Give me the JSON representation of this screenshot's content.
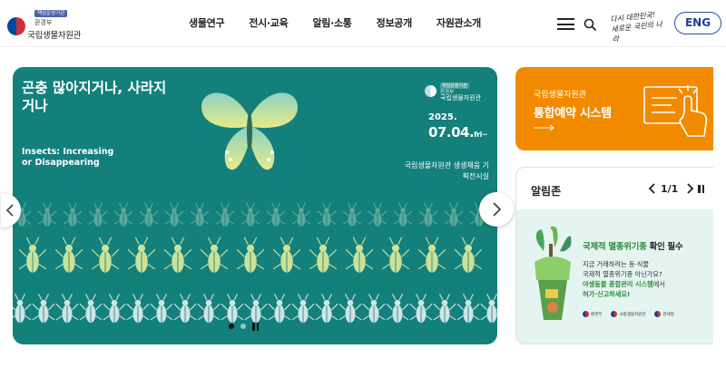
{
  "header": {
    "logo": {
      "badge": "책임운영기관",
      "ministry": "환경부",
      "name": "국립생물자원관"
    },
    "nav": [
      "생물연구",
      "전시·교육",
      "알림·소통",
      "정보공개",
      "자원관소개"
    ],
    "slogan": "다시 대한민국! 새로운 국민의 나라",
    "lang_button": "ENG"
  },
  "hero": {
    "title": "곤충 많아지거나, 사라지거나",
    "subtitle": "Insects: Increasing or Disappearing",
    "org_badge": "책임운영기관",
    "org_ministry": "환경부",
    "org_name": "국립생물자원관",
    "year": "2025.",
    "date": "07.04.",
    "weekday": "fri~",
    "venue": "국립생물자원관 생생채움 기획전시실",
    "slides_total": 2,
    "slide_active": 1,
    "colors": {
      "background": "#13807c",
      "beetle": "#d6e89a",
      "butterfly": "#c5e0a5"
    }
  },
  "reservation": {
    "subtitle": "국립생물자원관",
    "title": "통합예약 시스템",
    "color": "#f28a00"
  },
  "notice": {
    "title": "알림존",
    "page": "1/1",
    "heading_highlight": "국제적 멸종위기종",
    "heading_rest": " 확인 필수",
    "line1": "지금 거래하려는 동·식물",
    "line2": "국제적 멸종위기종 아닌가요?",
    "line3_highlight": "야생동물 종합관리 시스템",
    "line3_rest": "에서",
    "line4": "허가·신고하세요!",
    "footer_orgs": [
      "환경부",
      "국립생물자원관",
      "관세청"
    ],
    "background": "#e4f5f1"
  }
}
